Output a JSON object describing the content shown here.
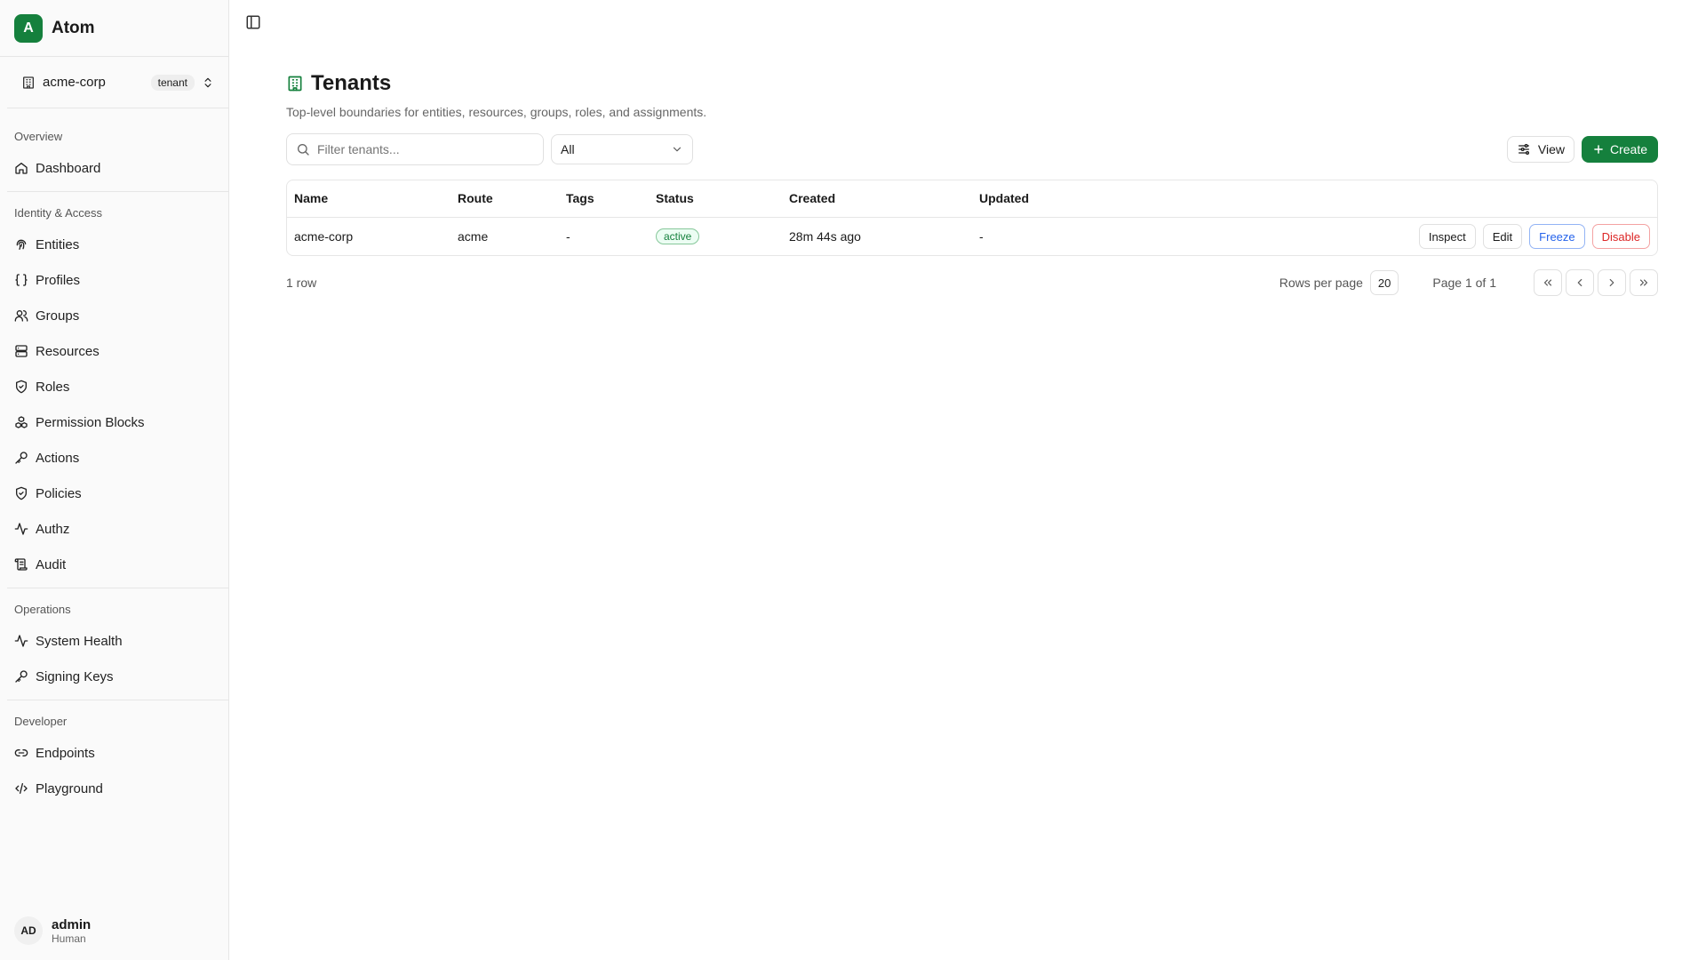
{
  "brand": {
    "logo_letter": "A",
    "name": "Atom",
    "accent": "#15803d"
  },
  "tenant_switcher": {
    "name": "acme-corp",
    "badge": "tenant"
  },
  "nav": {
    "sections": [
      {
        "title": "Overview",
        "items": [
          {
            "label": "Dashboard",
            "icon": "home-icon"
          }
        ]
      },
      {
        "title": "Identity & Access",
        "items": [
          {
            "label": "Entities",
            "icon": "fingerprint-icon"
          },
          {
            "label": "Profiles",
            "icon": "braces-icon"
          },
          {
            "label": "Groups",
            "icon": "users-icon"
          },
          {
            "label": "Resources",
            "icon": "server-icon"
          },
          {
            "label": "Roles",
            "icon": "shield-icon"
          },
          {
            "label": "Permission Blocks",
            "icon": "boxes-icon"
          },
          {
            "label": "Actions",
            "icon": "key-icon"
          },
          {
            "label": "Policies",
            "icon": "shield-check-icon"
          },
          {
            "label": "Authz",
            "icon": "activity-icon"
          },
          {
            "label": "Audit",
            "icon": "scroll-icon"
          }
        ]
      },
      {
        "title": "Operations",
        "items": [
          {
            "label": "System Health",
            "icon": "activity-icon"
          },
          {
            "label": "Signing Keys",
            "icon": "key-icon"
          }
        ]
      },
      {
        "title": "Developer",
        "items": [
          {
            "label": "Endpoints",
            "icon": "link-icon"
          },
          {
            "label": "Playground",
            "icon": "code-icon"
          }
        ]
      }
    ]
  },
  "user": {
    "initials": "AD",
    "name": "admin",
    "role": "Human"
  },
  "page": {
    "title": "Tenants",
    "description": "Top-level boundaries for entities, resources, groups, roles, and assignments."
  },
  "toolbar": {
    "search_placeholder": "Filter tenants...",
    "filter_value": "All",
    "view_label": "View",
    "create_label": "Create"
  },
  "table": {
    "columns": [
      "Name",
      "Route",
      "Tags",
      "Status",
      "Created",
      "Updated"
    ],
    "rows": [
      {
        "name": "acme-corp",
        "route": "acme",
        "tags": "-",
        "status": "active",
        "created": "28m 44s ago",
        "updated": "-",
        "actions": [
          "Inspect",
          "Edit",
          "Freeze",
          "Disable"
        ]
      }
    ]
  },
  "footer": {
    "row_count": "1 row",
    "rows_per_page_label": "Rows per page",
    "rows_per_page": "20",
    "page_label": "Page 1 of 1"
  }
}
